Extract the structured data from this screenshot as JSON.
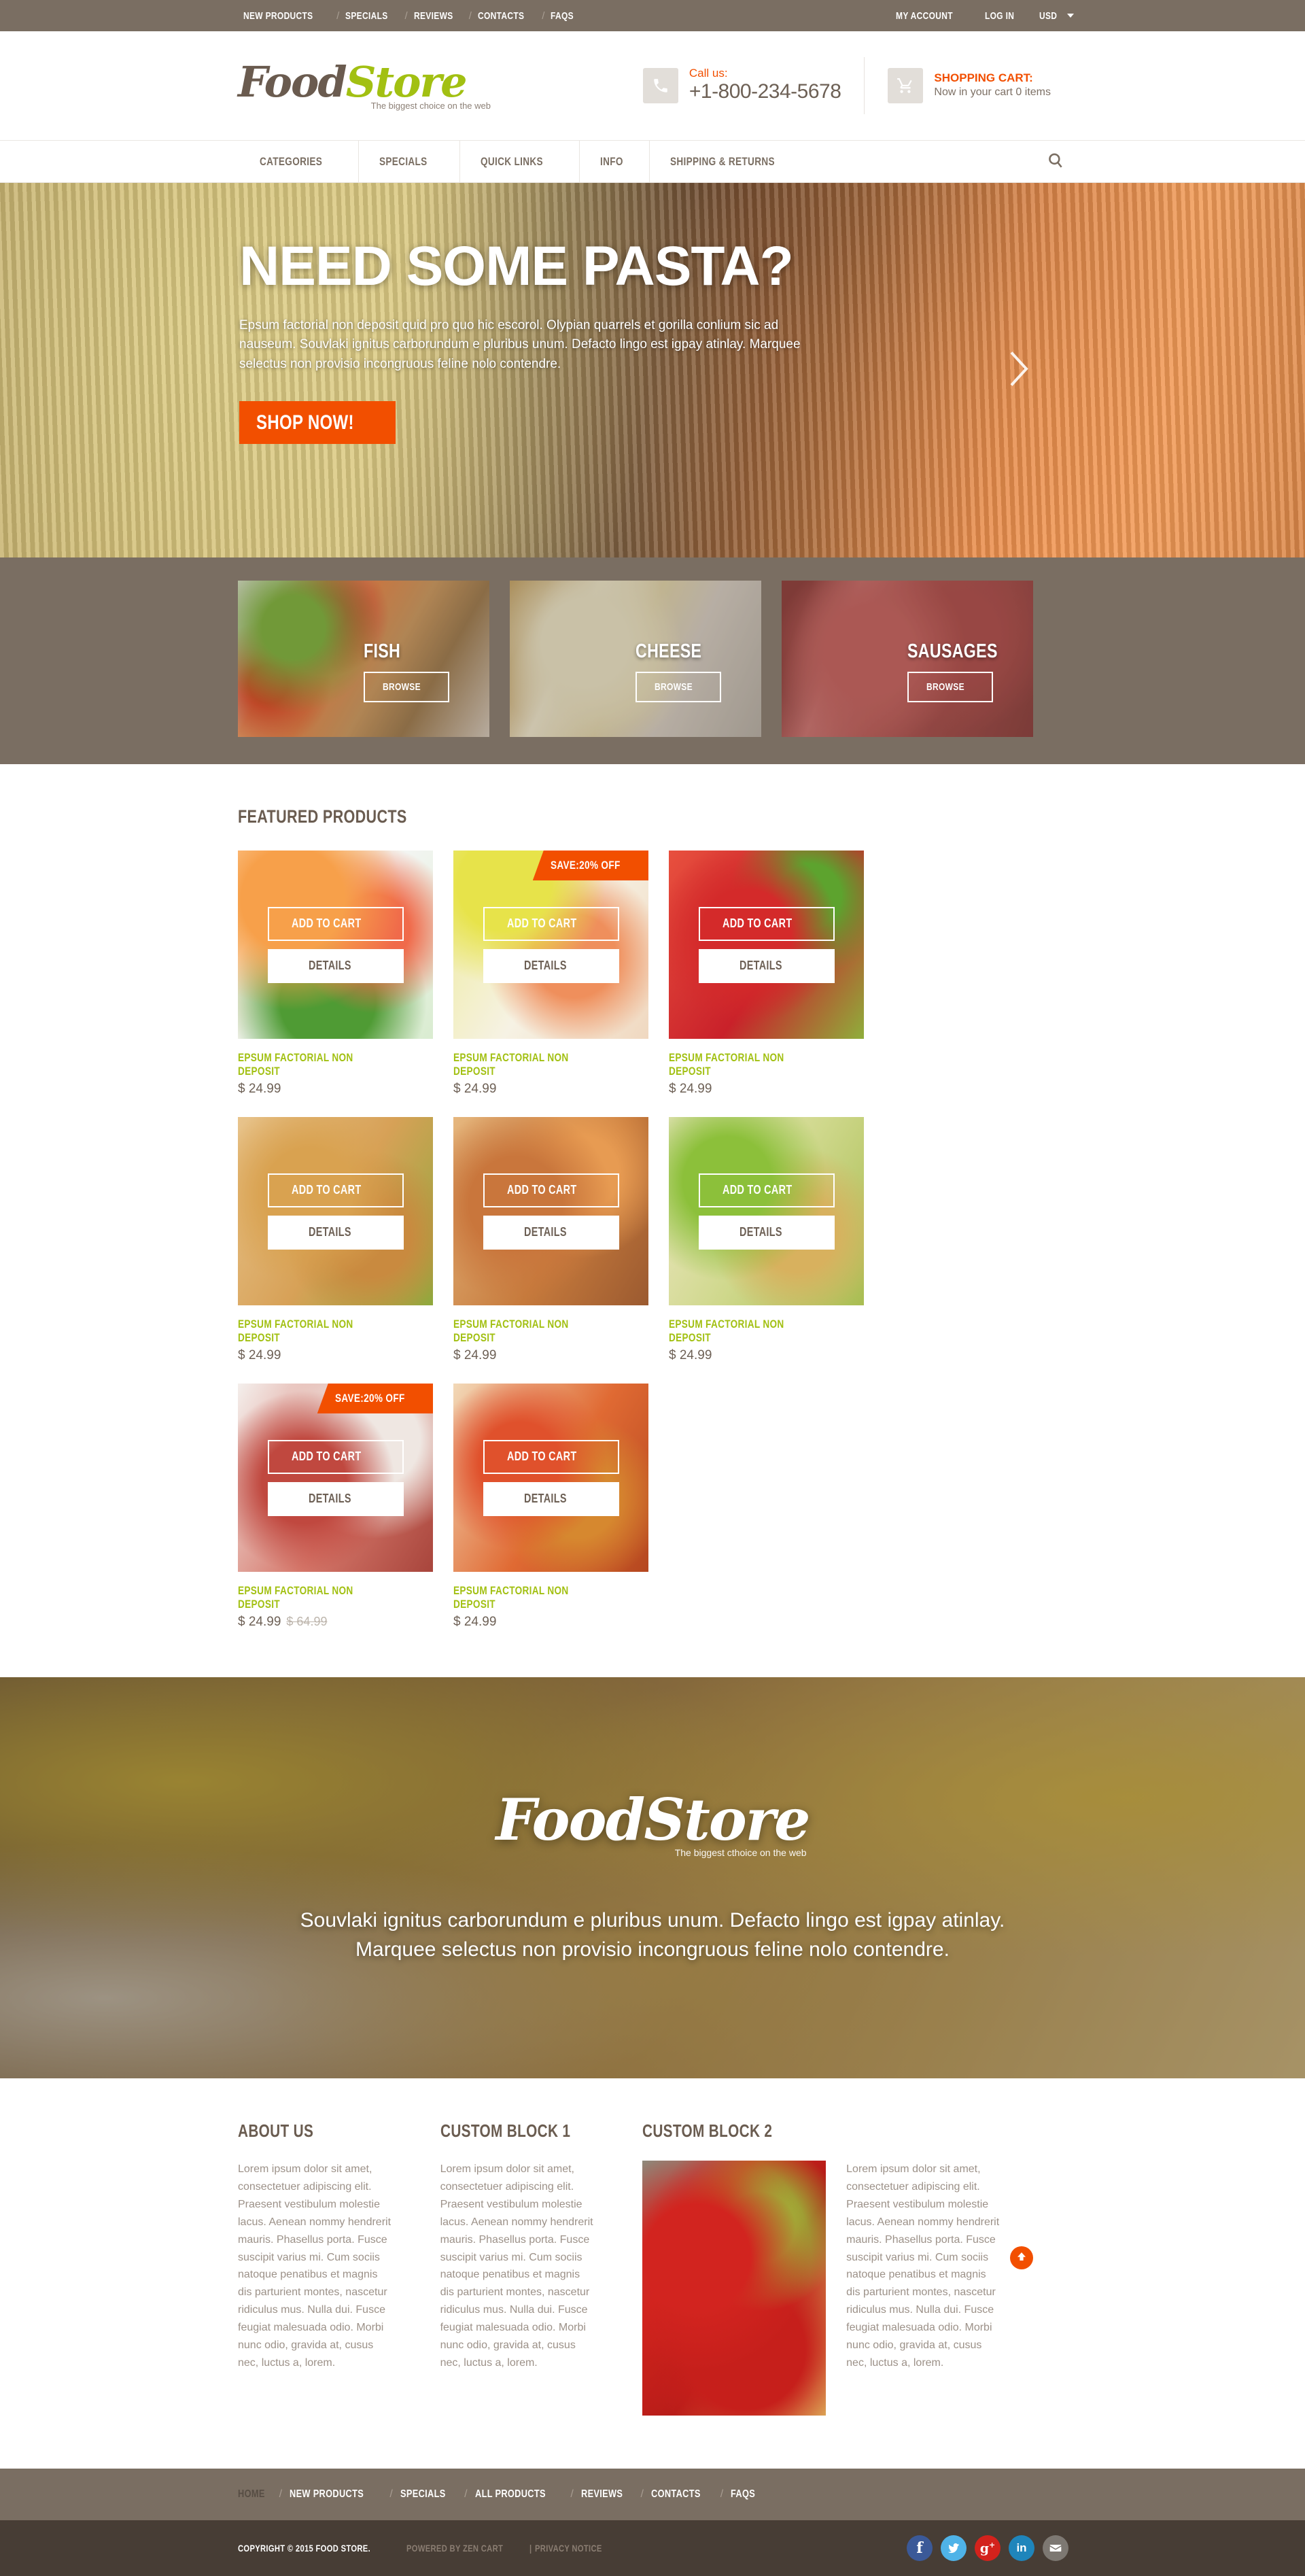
{
  "topbar": {
    "links": [
      "New Products",
      "Specials",
      "Reviews",
      "Contacts",
      "FAQs"
    ],
    "separator": "/",
    "my_account": "My Account",
    "log_in": "Log In",
    "currency": "USD"
  },
  "header": {
    "logo_part1": "Food",
    "logo_part2": "Store",
    "logo_tagline": "The biggest choice on the web",
    "call_label": "Call us:",
    "phone": "+1-800-234-5678",
    "cart_label": "SHOPPING CART:",
    "cart_status": "Now in your cart 0 items"
  },
  "mainnav": {
    "items": [
      "Categories",
      "Specials",
      "Quick Links",
      "Info",
      "Shipping & Returns"
    ]
  },
  "hero": {
    "title": "Need some pasta?",
    "text": "Epsum factorial non deposit quid pro quo hic escorol. Olypian quarrels et gorilla conlium sic ad nauseum. Souvlaki ignitus carborundum e pluribus unum. Defacto lingo est igpay atinlay. Marquee selectus non provisio incongruous feline nolo contendre.",
    "cta": "Shop Now!"
  },
  "categories": {
    "browse_label": "Browse",
    "items": [
      {
        "name": "Fish"
      },
      {
        "name": "Cheese"
      },
      {
        "name": "Sausages"
      }
    ]
  },
  "featured": {
    "title": "Featured Products",
    "add_to_cart": "Add to Cart",
    "details": "Details",
    "products": [
      {
        "name": "Epsum Factorial Non Deposit",
        "price": "$ 24.99",
        "old_price": "",
        "badge": ""
      },
      {
        "name": "Epsum Factorial Non Deposit",
        "price": "$ 24.99",
        "old_price": "",
        "badge": "SAVE:20% OFF"
      },
      {
        "name": "Epsum Factorial Non Deposit",
        "price": "$ 24.99",
        "old_price": "",
        "badge": ""
      },
      {
        "name": "Epsum Factorial Non Deposit",
        "price": "$ 24.99",
        "old_price": "",
        "badge": ""
      },
      {
        "name": "Epsum Factorial Non Deposit",
        "price": "$ 24.99",
        "old_price": "",
        "badge": ""
      },
      {
        "name": "Epsum Factorial Non Deposit",
        "price": "$ 24.99",
        "old_price": "",
        "badge": ""
      },
      {
        "name": "Epsum Factorial Non Deposit",
        "price": "$ 24.99",
        "old_price": "$ 64.99",
        "badge": "SAVE:20% OFF"
      },
      {
        "name": "Epsum Factorial Non Deposit",
        "price": "$ 24.99",
        "old_price": "",
        "badge": ""
      }
    ]
  },
  "midbanner": {
    "logo_part1": "Food",
    "logo_part2": "Store",
    "logo_tagline": "The biggest cthoice on the web",
    "text": "Souvlaki ignitus carborundum e pluribus unum. Defacto lingo est igpay atinlay. Marquee selectus non provisio incongruous feline nolo contendre."
  },
  "blocks": {
    "about_title": "About Us",
    "block1_title": "Custom Block 1",
    "block2_title": "Custom Block 2",
    "body": "Lorem ipsum dolor sit amet, consectetuer adipiscing elit. Praesent vestibulum molestie lacus. Aenean nommy hendrerit mauris. Phasellus porta. Fusce suscipit varius mi. Cum sociis natoque penatibus et magnis dis parturient montes, nascetur ridiculus mus. Nulla dui. Fusce feugiat malesuada odio. Morbi nunc odio, gravida at, cusus nec, luctus a, lorem."
  },
  "footer": {
    "nav": [
      "Home",
      "New Products",
      "Specials",
      "All Products",
      "Reviews",
      "Contacts",
      "FAQs"
    ],
    "separator": "/",
    "copyright": "Copyright © 2015 Food Store.",
    "powered": "Powered by Zen Cart",
    "privacy": "Privacy Notice",
    "pipe": "|",
    "socials": [
      {
        "name": "facebook",
        "glyph": "f",
        "color": "#3b5998"
      },
      {
        "name": "twitter",
        "glyph": "t",
        "color": "#4fb3e8"
      },
      {
        "name": "google-plus",
        "glyph": "g+",
        "color": "#d3221c"
      },
      {
        "name": "linkedin",
        "glyph": "in",
        "color": "#1f85bb"
      },
      {
        "name": "email",
        "glyph": "m",
        "color": "#7d7872"
      }
    ]
  },
  "colors": {
    "brand_brown": "#7a6e62",
    "accent_orange": "#f24f00",
    "accent_green": "#a2c012",
    "dark_footer": "#473d35"
  }
}
